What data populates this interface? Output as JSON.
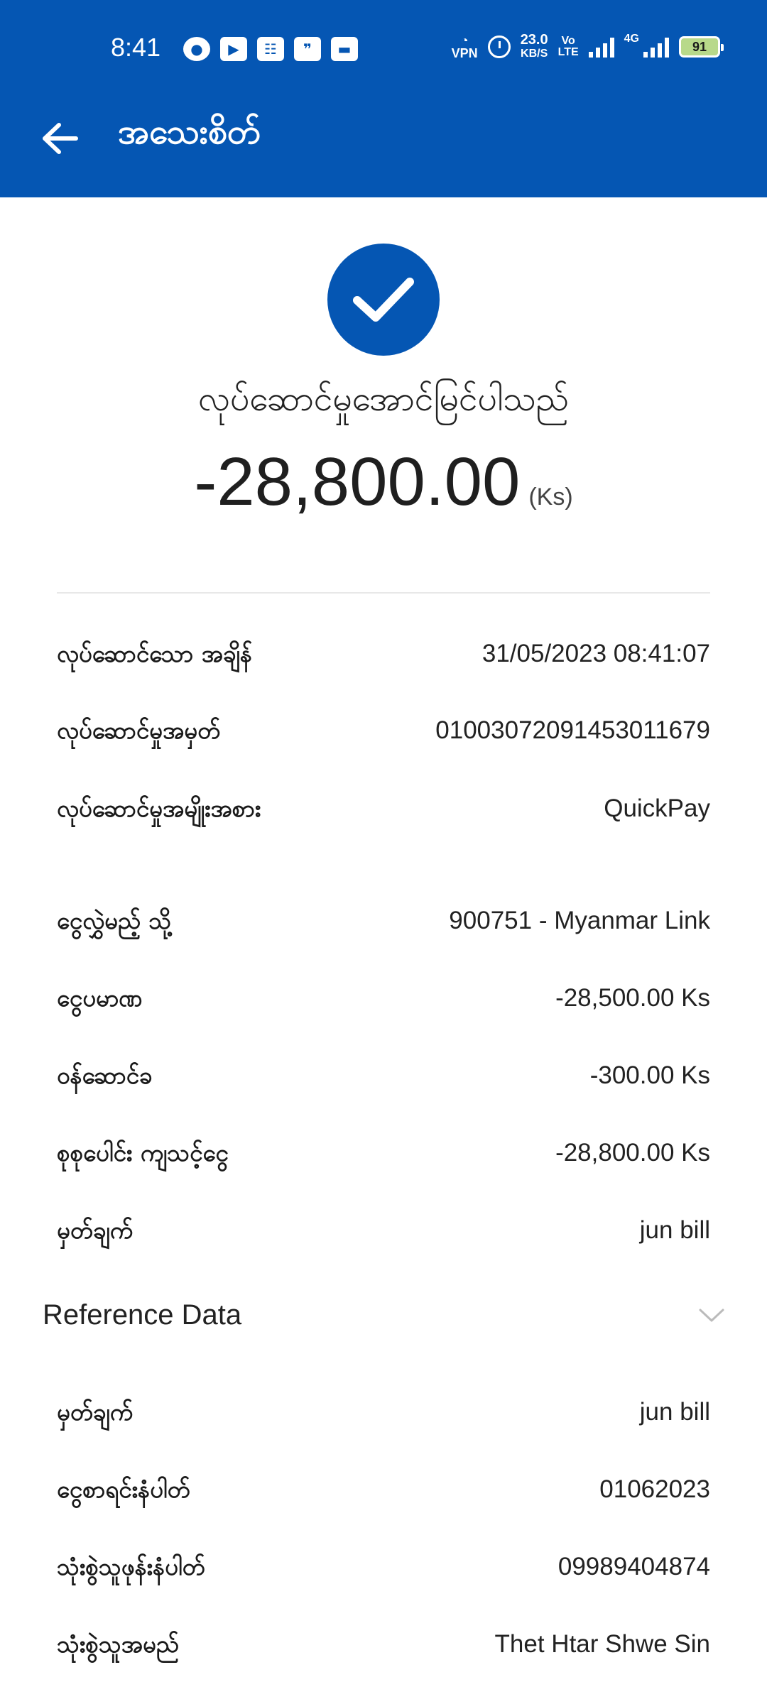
{
  "status_bar": {
    "time": "8:41",
    "network_speed_value": "23.0",
    "network_speed_unit": "KB/S",
    "vpn": "VPN",
    "volte": "Vo\nLTE",
    "signal_2_label": "4G",
    "battery": "91"
  },
  "header": {
    "title": "အသေးစိတ်"
  },
  "summary": {
    "status_text": "လုပ်ဆောင်မှုအောင်မြင်ပါသည်",
    "amount": "-28,800.00",
    "currency": "(Ks)"
  },
  "details": [
    {
      "label": "လုပ်ဆောင်သော အချိန်",
      "value": "31/05/2023 08:41:07"
    },
    {
      "label": "လုပ်ဆောင်မှုအမှတ်",
      "value": "01003072091453011679"
    },
    {
      "label": "လုပ်ဆောင်မှုအမျိုးအစား",
      "value": "QuickPay"
    },
    {
      "label": "ငွေလွှဲမည့် သို့",
      "value": "900751 - Myanmar Link"
    },
    {
      "label": "ငွေပမာဏ",
      "value": "-28,500.00 Ks"
    },
    {
      "label": "ဝန်ဆောင်ခ",
      "value": "-300.00 Ks"
    },
    {
      "label": "စုစုပေါင်း ကျသင့်ငွေ",
      "value": "-28,800.00 Ks"
    },
    {
      "label": "မှတ်ချက်",
      "value": "jun bill"
    }
  ],
  "reference": {
    "title": "Reference Data",
    "rows": [
      {
        "label": "မှတ်ချက်",
        "value": "jun bill"
      },
      {
        "label": "ငွေစာရင်းနံပါတ်",
        "value": "01062023"
      },
      {
        "label": "သုံးစွဲသူဖုန်းနံပါတ်",
        "value": "09989404874"
      },
      {
        "label": "သုံးစွဲသူအမည်",
        "value": "Thet Htar Shwe Sin"
      }
    ]
  },
  "colors": {
    "brand_blue": "#0556b3"
  }
}
